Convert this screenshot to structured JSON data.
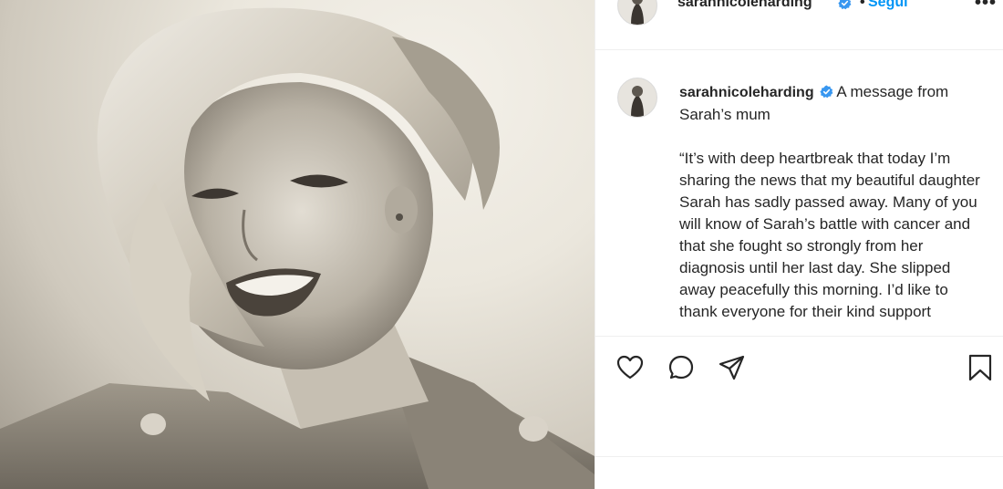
{
  "post": {
    "username": "sarahnicoleharding",
    "follow_label": "Segui",
    "separator": "•",
    "more_label": "•••",
    "caption_intro": "A message from Sarah’s mum",
    "caption_body": "“It’s with deep heartbreak that today I’m sharing the news that my beautiful daughter Sarah has sadly passed away. Many of you will know of Sarah’s battle with cancer and that she fought so strongly from her diagnosis until her last day. She slipped away peacefully this morning. I’d like to thank everyone for their kind support"
  },
  "icons": {
    "verified": "verified-badge-icon",
    "like": "heart-icon",
    "comment": "comment-bubble-icon",
    "share": "paper-plane-icon",
    "save": "bookmark-icon"
  },
  "colors": {
    "accent": "#0095f6",
    "text": "#262626",
    "border": "#efefef"
  }
}
